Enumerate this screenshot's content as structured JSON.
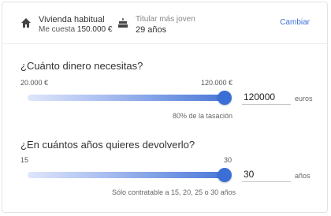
{
  "header": {
    "home": {
      "title": "Vivienda habitual",
      "cost_label": "Me cuesta",
      "cost_value": "150.000 €"
    },
    "holder": {
      "label": "Titular más joven",
      "value": "29 años"
    },
    "change_label": "Cambiar"
  },
  "amount": {
    "question": "¿Cuánto dinero necesitas?",
    "min_label": "20.000 €",
    "max_label": "120.000 €",
    "min": 20000,
    "max": 120000,
    "value": 120000,
    "input_value": "120000",
    "unit": "euros",
    "hint": "80% de la tasación"
  },
  "years": {
    "question": "¿En cuántos años quieres devolverlo?",
    "min_label": "15",
    "max_label": "30",
    "min": 15,
    "max": 30,
    "value": 30,
    "input_value": "30",
    "unit": "años",
    "hint": "Sólo contratable a 15, 20, 25 o 30 años"
  },
  "icons": {
    "home": "home-icon",
    "holder": "cake-icon"
  },
  "colors": {
    "accent": "#3b6fd6",
    "link": "#3a6fd8"
  }
}
